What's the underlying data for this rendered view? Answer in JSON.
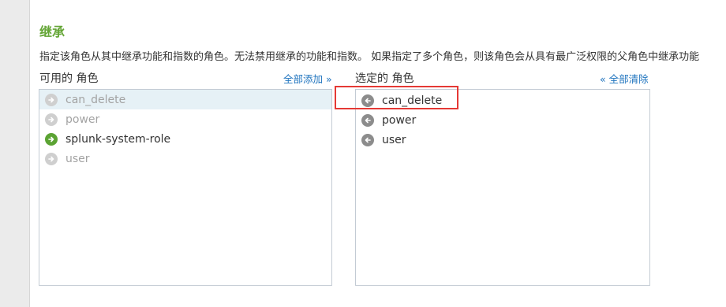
{
  "section": {
    "title": "继承",
    "description": "指定该角色从其中继承功能和指数的角色。无法禁用继承的功能和指数。 如果指定了多个角色，则该角色会从具有最广泛权限的父角色中继承功能"
  },
  "available": {
    "label": "可用的 角色",
    "add_all": "全部添加 »",
    "items": [
      {
        "name": "can_delete",
        "state": "disabled"
      },
      {
        "name": "power",
        "state": "disabled"
      },
      {
        "name": "splunk-system-role",
        "state": "available"
      },
      {
        "name": "user",
        "state": "disabled"
      }
    ]
  },
  "selected": {
    "label": "选定的 角色",
    "clear_all": "« 全部清除",
    "items": [
      {
        "name": "can_delete"
      },
      {
        "name": "power"
      },
      {
        "name": "user"
      }
    ]
  },
  "colors": {
    "title_green": "#65a637",
    "link_blue": "#1e73be",
    "highlight_red": "#e53935"
  }
}
